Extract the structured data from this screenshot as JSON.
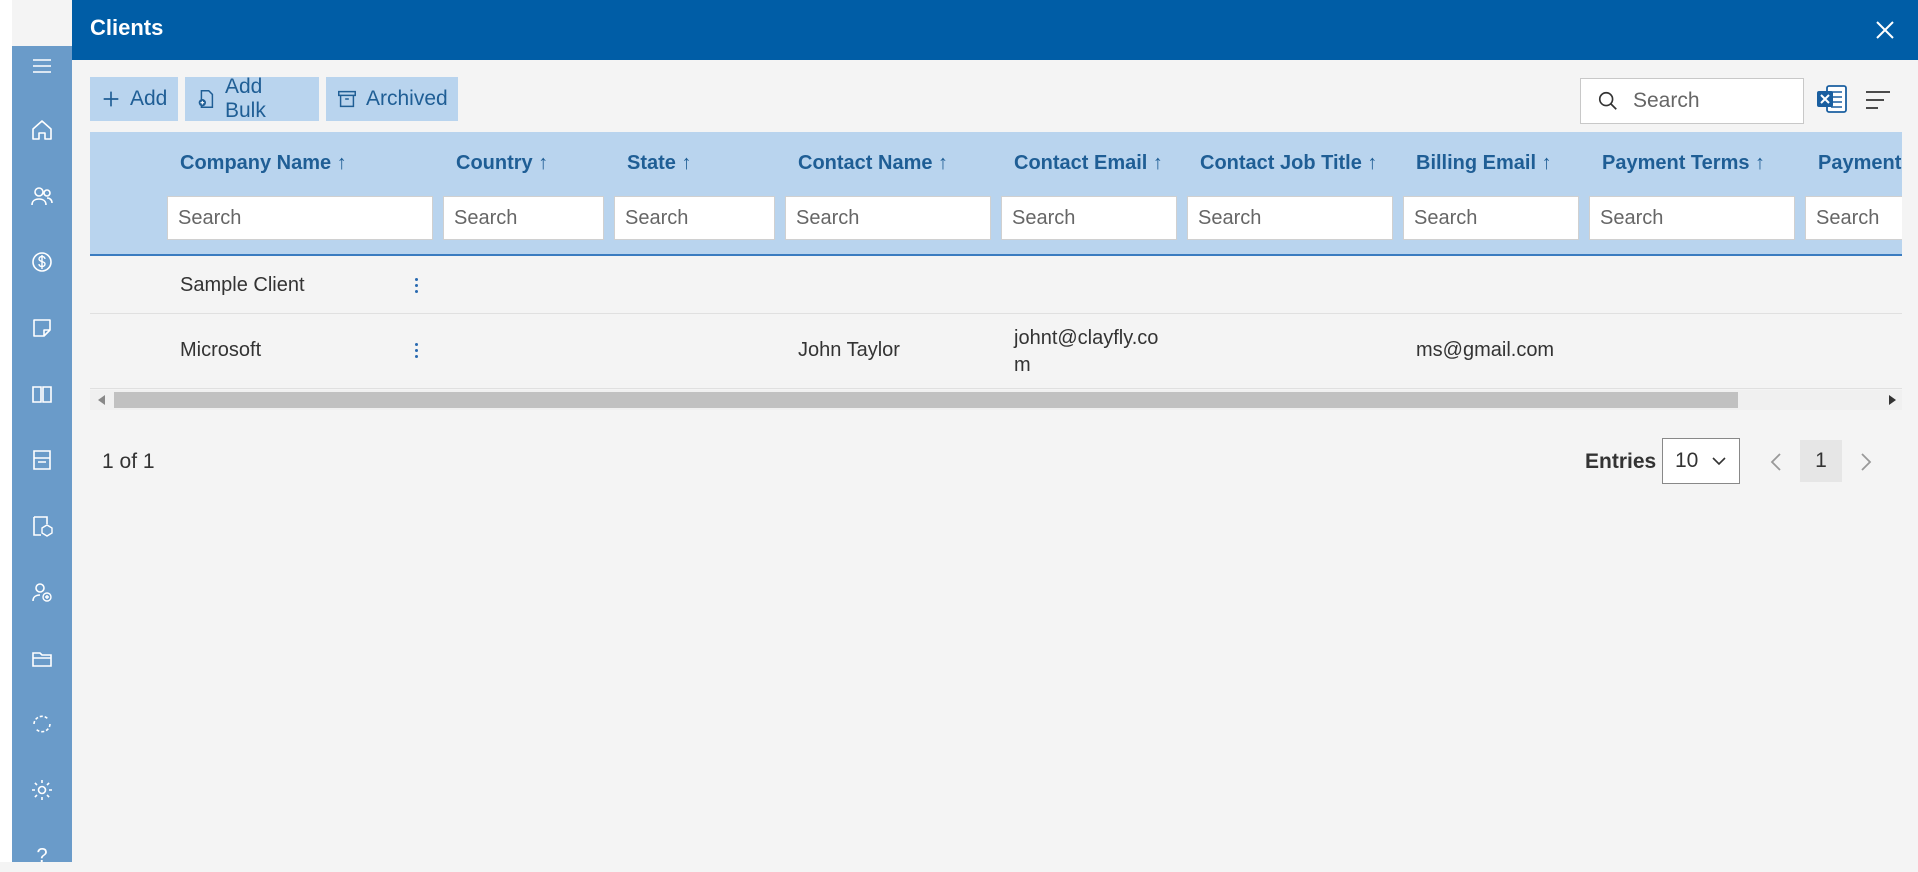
{
  "window": {
    "title": "Clients"
  },
  "toolbar": {
    "add_label": "Add",
    "add_bulk_label": "Add Bulk",
    "archived_label": "Archived"
  },
  "search": {
    "placeholder": "Search"
  },
  "sidebar": {
    "items": [
      "menu-icon",
      "home-icon",
      "users-icon",
      "dollar-icon",
      "note-icon",
      "book-icon",
      "invoice-icon",
      "package-icon",
      "user-add-icon",
      "folder-icon",
      "sync-icon",
      "gear-icon",
      "help-icon"
    ],
    "help_label": "?"
  },
  "table": {
    "columns": [
      {
        "label": "Company Name ↑",
        "filter_placeholder": "Search"
      },
      {
        "label": "Country ↑",
        "filter_placeholder": "Search"
      },
      {
        "label": "State ↑",
        "filter_placeholder": "Search"
      },
      {
        "label": "Contact Name ↑",
        "filter_placeholder": "Search"
      },
      {
        "label": "Contact Email ↑",
        "filter_placeholder": "Search"
      },
      {
        "label": "Contact Job Title ↑",
        "filter_placeholder": "Search"
      },
      {
        "label": "Billing Email ↑",
        "filter_placeholder": "Search"
      },
      {
        "label": "Payment Terms ↑",
        "filter_placeholder": "Search"
      },
      {
        "label": "Payment",
        "filter_placeholder": "Search"
      }
    ],
    "rows": [
      {
        "company": "Sample Client",
        "contact_name": "",
        "contact_email_1": "",
        "contact_email_2": "",
        "billing_email": ""
      },
      {
        "company": "Microsoft",
        "contact_name": "John Taylor",
        "contact_email_1": "johnt@clayfly.co",
        "contact_email_2": "m",
        "billing_email": "ms@gmail.com"
      }
    ]
  },
  "pager": {
    "count_text": "1 of 1",
    "entries_label": "Entries",
    "entries_value": "10",
    "current_page": "1"
  },
  "colors": {
    "titlebar": "#005da6",
    "sidebar": "#6a9bc9",
    "header": "#b9d4ee",
    "accent_text": "#1f5e95"
  }
}
